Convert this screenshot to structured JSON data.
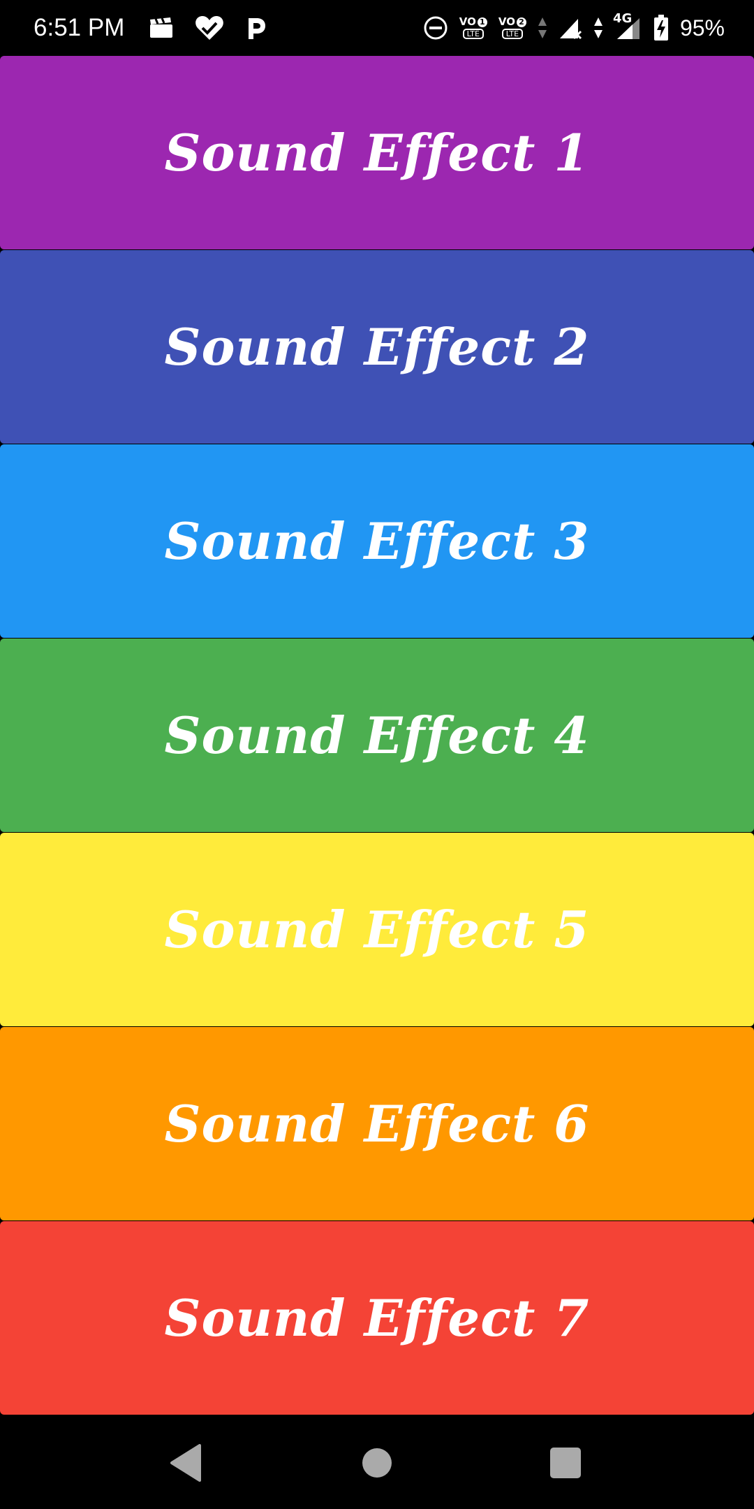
{
  "status_bar": {
    "time": "6:51 PM",
    "volte1": {
      "label": "VO",
      "sim": "1",
      "tech": "LTE"
    },
    "volte2": {
      "label": "VO",
      "sim": "2",
      "tech": "LTE"
    },
    "network_type": "4G",
    "battery_percent": "95%",
    "icons": [
      "clapperboard-icon",
      "heart-check-icon",
      "parking-p-icon",
      "do-not-disturb-icon",
      "data-arrows-icon",
      "signal-no-service-icon",
      "signal-4g-icon",
      "battery-charging-icon"
    ]
  },
  "sound_buttons": [
    {
      "label": "Sound Effect 1",
      "color": "#9C27B0"
    },
    {
      "label": "Sound Effect 2",
      "color": "#3F51B5"
    },
    {
      "label": "Sound Effect 3",
      "color": "#2196F3"
    },
    {
      "label": "Sound Effect 4",
      "color": "#4CAF50"
    },
    {
      "label": "Sound Effect 5",
      "color": "#FFEB3B"
    },
    {
      "label": "Sound Effect 6",
      "color": "#FF9800"
    },
    {
      "label": "Sound Effect 7",
      "color": "#F44336"
    }
  ],
  "nav_bar": {
    "icons": [
      "back-triangle-icon",
      "home-circle-icon",
      "recents-square-icon"
    ]
  }
}
